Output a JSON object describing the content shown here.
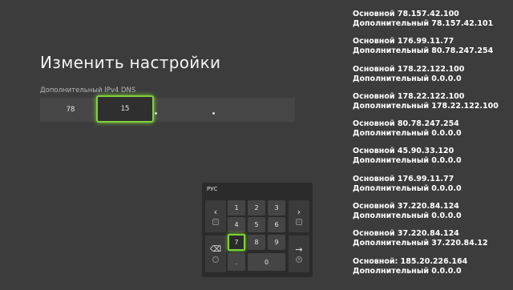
{
  "page": {
    "title": "Изменить настройки",
    "field_label": "Дополнительный IPv4 DNS"
  },
  "ip": {
    "octets": [
      "78",
      "15",
      "",
      ""
    ]
  },
  "keyboard": {
    "lang": "РУС",
    "keys": {
      "k1": "1",
      "k2": "2",
      "k3": "3",
      "k4": "4",
      "k5": "5",
      "k6": "6",
      "k7": "7",
      "k8": "8",
      "k9": "9",
      "kdot": ".",
      "k0": "0"
    },
    "icons": [
      "chevron-left-icon",
      "chevron-right-icon",
      "backspace-icon",
      "enter-arrow-icon"
    ]
  },
  "dns_list": [
    {
      "primary": "Основной 78.157.42.100",
      "secondary": "Дополнительный 78.157.42.101"
    },
    {
      "primary": "Основной 176.99.11.77",
      "secondary": "Дополнительный 80.78.247.254"
    },
    {
      "primary": "Основной 178.22.122.100",
      "secondary": "Дополнительный 0.0.0.0"
    },
    {
      "primary": "Основной 178.22.122.100",
      "secondary": "Дополнительный 178.22.122.100"
    },
    {
      "primary": "Основной 80.78.247.254",
      "secondary": "Дополнительный 0.0.0.0"
    },
    {
      "primary": "Основной 45.90.33.120",
      "secondary": "Дополнительный 0.0.0.0"
    },
    {
      "primary": "Основной 176.99.11.77",
      "secondary": "Дополнительный 0.0.0.0"
    },
    {
      "primary": "Основной 37.220.84.124",
      "secondary": "Дополнительный 0.0.0.0"
    },
    {
      "primary": "Основной 37.220.84.124",
      "secondary": "Дополнительный 37.220.84.12"
    },
    {
      "primary": "Основной: 185.20.226.164",
      "secondary": "Дополнительный 0.0.0.0"
    }
  ],
  "colors": {
    "background": "#3c3c3c",
    "focus_accent": "#7fd13b"
  }
}
